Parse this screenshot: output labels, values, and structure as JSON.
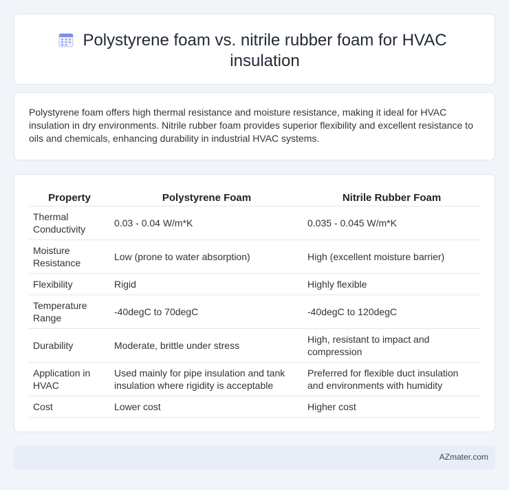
{
  "header": {
    "title": "Polystyrene foam vs. nitrile rubber foam for HVAC insulation",
    "icon": "calendar-icon"
  },
  "summary": {
    "text": "Polystyrene foam offers high thermal resistance and moisture resistance, making it ideal for HVAC insulation in dry environments. Nitrile rubber foam provides superior flexibility and excellent resistance to oils and chemicals, enhancing durability in industrial HVAC systems."
  },
  "table": {
    "headers": [
      "Property",
      "Polystyrene Foam",
      "Nitrile Rubber Foam"
    ],
    "rows": [
      [
        "Thermal Conductivity",
        "0.03 - 0.04 W/m*K",
        "0.035 - 0.045 W/m*K"
      ],
      [
        "Moisture Resistance",
        "Low (prone to water absorption)",
        "High (excellent moisture barrier)"
      ],
      [
        "Flexibility",
        "Rigid",
        "Highly flexible"
      ],
      [
        "Temperature Range",
        "-40degC to 70degC",
        "-40degC to 120degC"
      ],
      [
        "Durability",
        "Moderate, brittle under stress",
        "High, resistant to impact and compression"
      ],
      [
        "Application in HVAC",
        "Used mainly for pipe insulation and tank insulation where rigidity is acceptable",
        "Preferred for flexible duct insulation and environments with humidity"
      ],
      [
        "Cost",
        "Lower cost",
        "Higher cost"
      ]
    ]
  },
  "footer": {
    "text": "AZmater.com"
  },
  "colors": {
    "page_background": "#f1f4f9",
    "card_background": "#ffffff",
    "footer_background": "#e8eef8",
    "icon_accent": "#7b8ee8"
  }
}
